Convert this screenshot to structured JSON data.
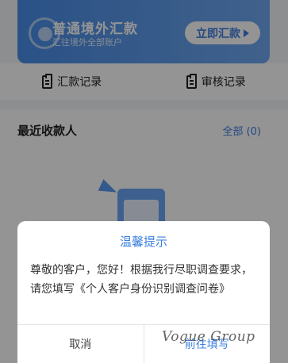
{
  "banner": {
    "title": "普通境外汇款",
    "subtitle": "汇往境外全部账户",
    "button_label": "立即汇款"
  },
  "records": {
    "remit_label": "汇款记录",
    "review_label": "审核记录"
  },
  "recent": {
    "title": "最近收款人",
    "all_label": "全部 (0)"
  },
  "dialog": {
    "title": "温馨提示",
    "body": "尊敬的客户，您好！根据我行尽职调查要求，请您填写《个人客户身份识别调查问卷》",
    "cancel_label": "取消",
    "confirm_label": "前往填写"
  },
  "watermark": "Vogue Group",
  "colors": {
    "accent": "#3b7fe0",
    "banner_start": "#4a8ee8",
    "banner_end": "#6fa8f0"
  }
}
